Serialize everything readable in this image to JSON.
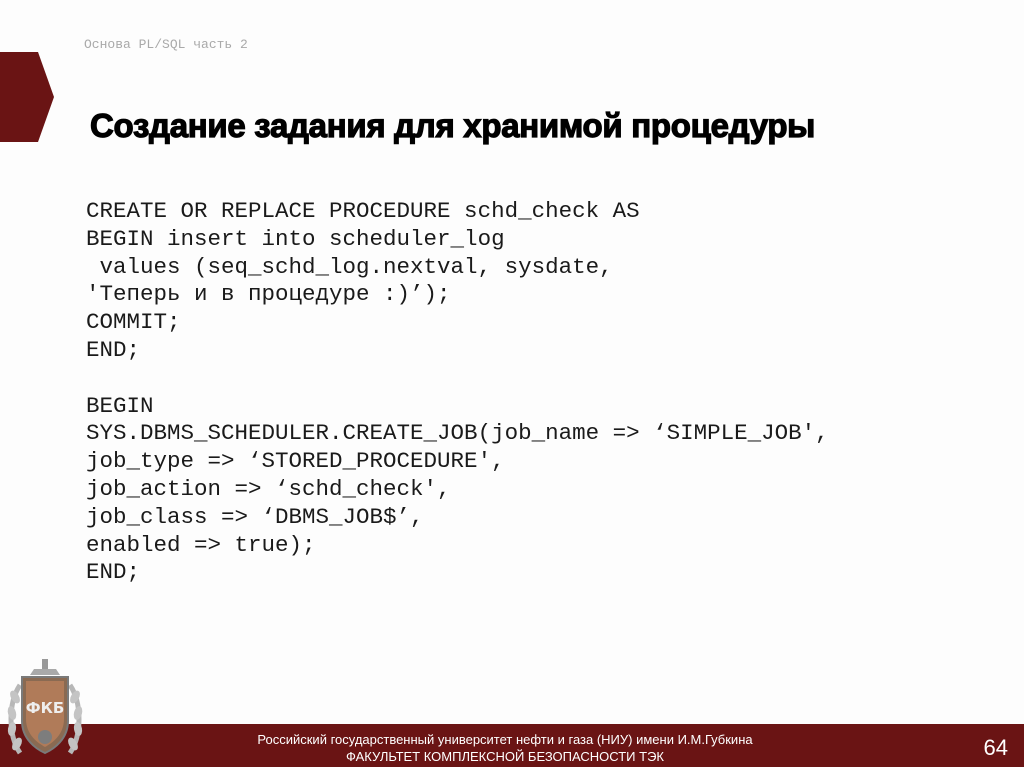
{
  "header": {
    "caption": "Основа PL/SQL часть 2"
  },
  "title": "Создание задания для хранимой процедуры",
  "code_lines": [
    "CREATE OR REPLACE PROCEDURE schd_check AS",
    "BEGIN insert into scheduler_log",
    " values (seq_schd_log.nextval, sysdate,",
    "'Теперь и в процедуре :)’);",
    "COMMIT;",
    "END;",
    "",
    "BEGIN",
    "SYS.DBMS_SCHEDULER.CREATE_JOB(job_name => ‘SIMPLE_JOB',",
    "job_type => ‘STORED_PROCEDURE',",
    "job_action => ‘schd_check',",
    "job_class => ‘DBMS_JOB$’,",
    "enabled => true);",
    "END;"
  ],
  "footer": {
    "university": "Российский государственный университет нефти и газа (НИУ) имени И.М.Губкина",
    "faculty": "ФАКУЛЬТЕТ КОМПЛЕКСНОЙ БЕЗОПАСНОСТИ ТЭК",
    "page_number": "64",
    "emblem_text": "ФКБ"
  },
  "colors": {
    "accent": "#6a1414",
    "caption": "#a9a9a9"
  }
}
